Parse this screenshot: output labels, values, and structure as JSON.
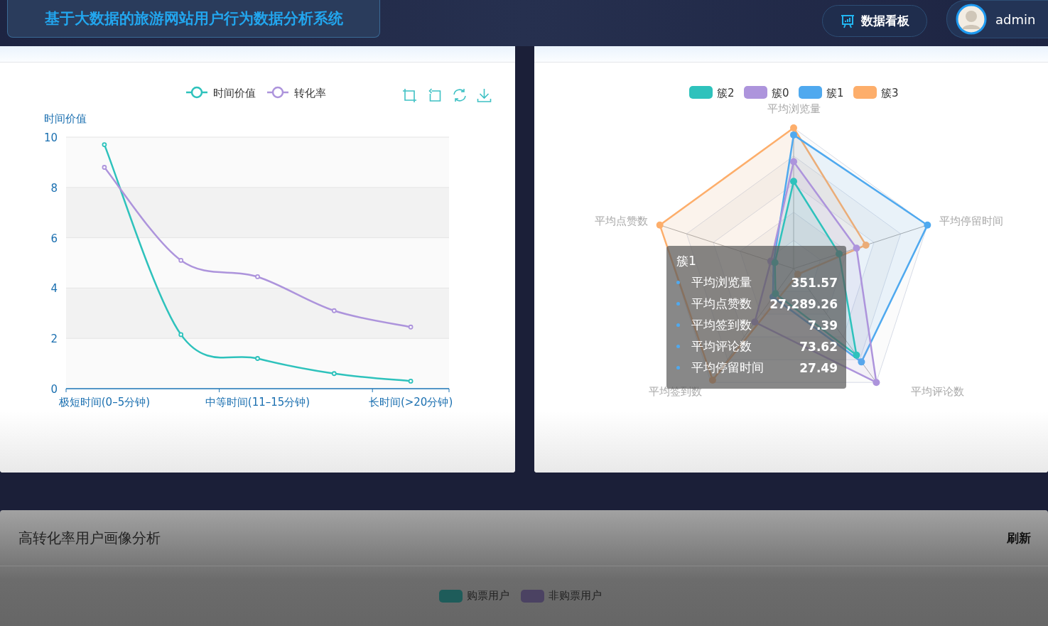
{
  "header": {
    "title": "基于大数据的旅游网站用户行为数据分析系统",
    "nav_button": {
      "label": "数据看板"
    },
    "user": {
      "name": "admin"
    }
  },
  "time_value_panel": {
    "chart_data": {
      "type": "line",
      "ylabel": "时间价值",
      "categories": [
        "极短时间(0–5分钟)",
        null,
        "中等时间(11–15分钟)",
        null,
        "长时间(>20分钟)"
      ],
      "ylim": [
        0,
        10
      ],
      "yticks": [
        0,
        2,
        4,
        6,
        8,
        10
      ],
      "grid": true,
      "legend": "top",
      "series": [
        {
          "name": "时间价值",
          "color": "#2ec2bc",
          "marker": "circle",
          "values": [
            9.7,
            2.15,
            1.2,
            0.6,
            0.3
          ]
        },
        {
          "name": "转化率",
          "color": "#ad94dc",
          "marker": "circle",
          "values": [
            8.8,
            5.1,
            4.45,
            3.1,
            2.45
          ]
        }
      ]
    }
  },
  "cluster_panel": {
    "legend": [
      {
        "label": "簇2",
        "color": "#2ec2bc"
      },
      {
        "label": "簇0",
        "color": "#ad94dc"
      },
      {
        "label": "簇1",
        "color": "#4fa9ef"
      },
      {
        "label": "簇3",
        "color": "#fdae6b"
      }
    ],
    "axes": [
      "平均浏览量",
      "平均停留时间",
      "平均评论数",
      "平均签到数",
      "平均点赞数"
    ],
    "tooltip": {
      "title": "簇1",
      "rows": [
        {
          "label": "平均浏览量",
          "value": "351.57"
        },
        {
          "label": "平均点赞数",
          "value": "27,289.26"
        },
        {
          "label": "平均签到数",
          "value": "7.39"
        },
        {
          "label": "平均评论数",
          "value": "73.62"
        },
        {
          "label": "平均停留时间",
          "value": "27.49"
        }
      ]
    }
  },
  "portrait_panel": {
    "title": "高转化率用户画像分析",
    "refresh_label": "刷新",
    "legend": [
      {
        "label": "购票用户",
        "color": "#1e5c5a"
      },
      {
        "label": "非购票用户",
        "color": "#4b4262"
      }
    ]
  }
}
